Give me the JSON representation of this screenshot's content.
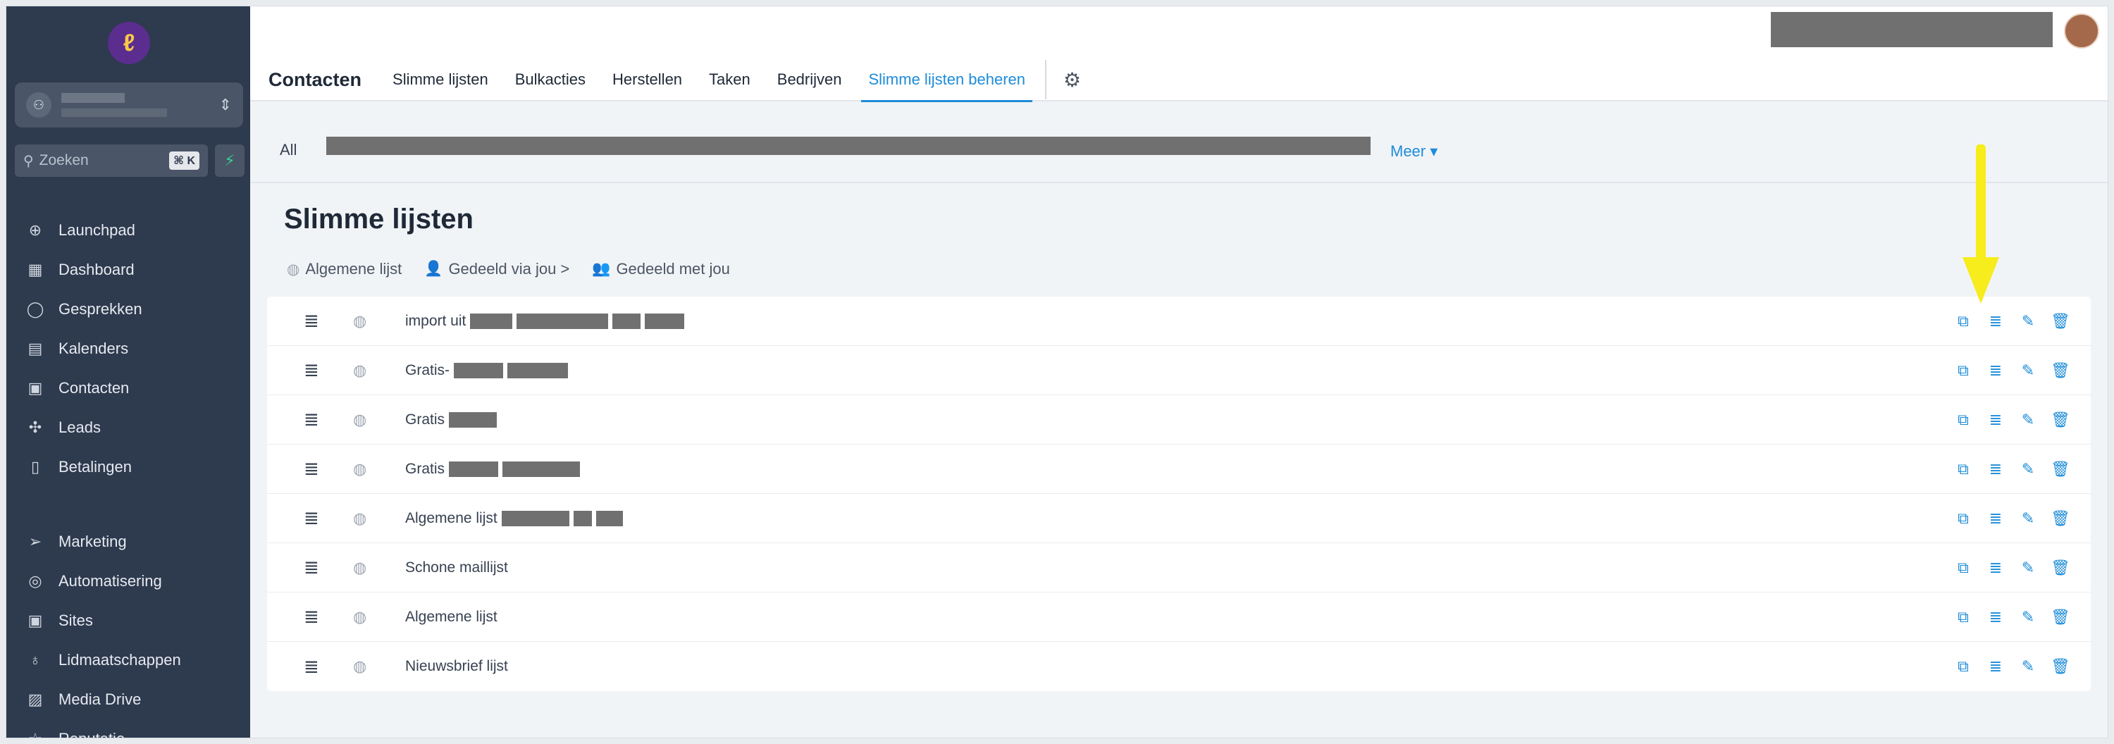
{
  "sidebar": {
    "logo_glyph": "ℓ",
    "search_placeholder": "Zoeken",
    "search_shortcut": "⌘ K",
    "nav_primary": [
      {
        "label": "Launchpad",
        "icon": "rocket-icon",
        "glyph": "⊕"
      },
      {
        "label": "Dashboard",
        "icon": "dashboard-icon",
        "glyph": "▦"
      },
      {
        "label": "Gesprekken",
        "icon": "chat-icon",
        "glyph": "◯"
      },
      {
        "label": "Kalenders",
        "icon": "calendar-icon",
        "glyph": "▤"
      },
      {
        "label": "Contacten",
        "icon": "contacts-icon",
        "glyph": "▣"
      },
      {
        "label": "Leads",
        "icon": "leads-icon",
        "glyph": "✣"
      },
      {
        "label": "Betalingen",
        "icon": "payments-icon",
        "glyph": "▯"
      }
    ],
    "nav_secondary": [
      {
        "label": "Marketing",
        "icon": "send-icon",
        "glyph": "➢"
      },
      {
        "label": "Automatisering",
        "icon": "automation-icon",
        "glyph": "◎"
      },
      {
        "label": "Sites",
        "icon": "sites-icon",
        "glyph": "▣"
      },
      {
        "label": "Lidmaatschappen",
        "icon": "membership-icon",
        "glyph": "♁"
      },
      {
        "label": "Media Drive",
        "icon": "image-icon",
        "glyph": "▨"
      },
      {
        "label": "Reputatie",
        "icon": "star-icon",
        "glyph": "☆"
      }
    ]
  },
  "header": {
    "app_title": "Contacten",
    "tabs": [
      "Slimme lijsten",
      "Bulkacties",
      "Herstellen",
      "Taken",
      "Bedrijven",
      "Slimme lijsten beheren"
    ],
    "active_tab": "Slimme lijsten beheren"
  },
  "filterbar": {
    "all_label": "All",
    "more_label": "Meer ▾"
  },
  "page": {
    "title": "Slimme lijsten",
    "sub_tabs": [
      {
        "label": "Algemene lijst",
        "icon": "globe-icon",
        "glyph": "◍"
      },
      {
        "label": "Gedeeld via jou  >",
        "icon": "user-plus-icon",
        "glyph": "👤"
      },
      {
        "label": "Gedeeld met jou",
        "icon": "users-icon",
        "glyph": "👥"
      }
    ]
  },
  "rows": [
    {
      "name": "import uit"
    },
    {
      "name": "Gratis-"
    },
    {
      "name": "Gratis"
    },
    {
      "name": "Gratis"
    },
    {
      "name": "Algemene lijst"
    },
    {
      "name": "Schone maillijst"
    },
    {
      "name": "Algemene lijst"
    },
    {
      "name": "Nieuwsbrief lijst"
    }
  ],
  "row_action_icons": [
    "copy-icon",
    "list-icon",
    "edit-icon",
    "trash-icon"
  ],
  "colors": {
    "sidebar_bg": "#2e3a4e",
    "accent": "#1d8cd8",
    "annotation_arrow": "#f7ec1c"
  }
}
